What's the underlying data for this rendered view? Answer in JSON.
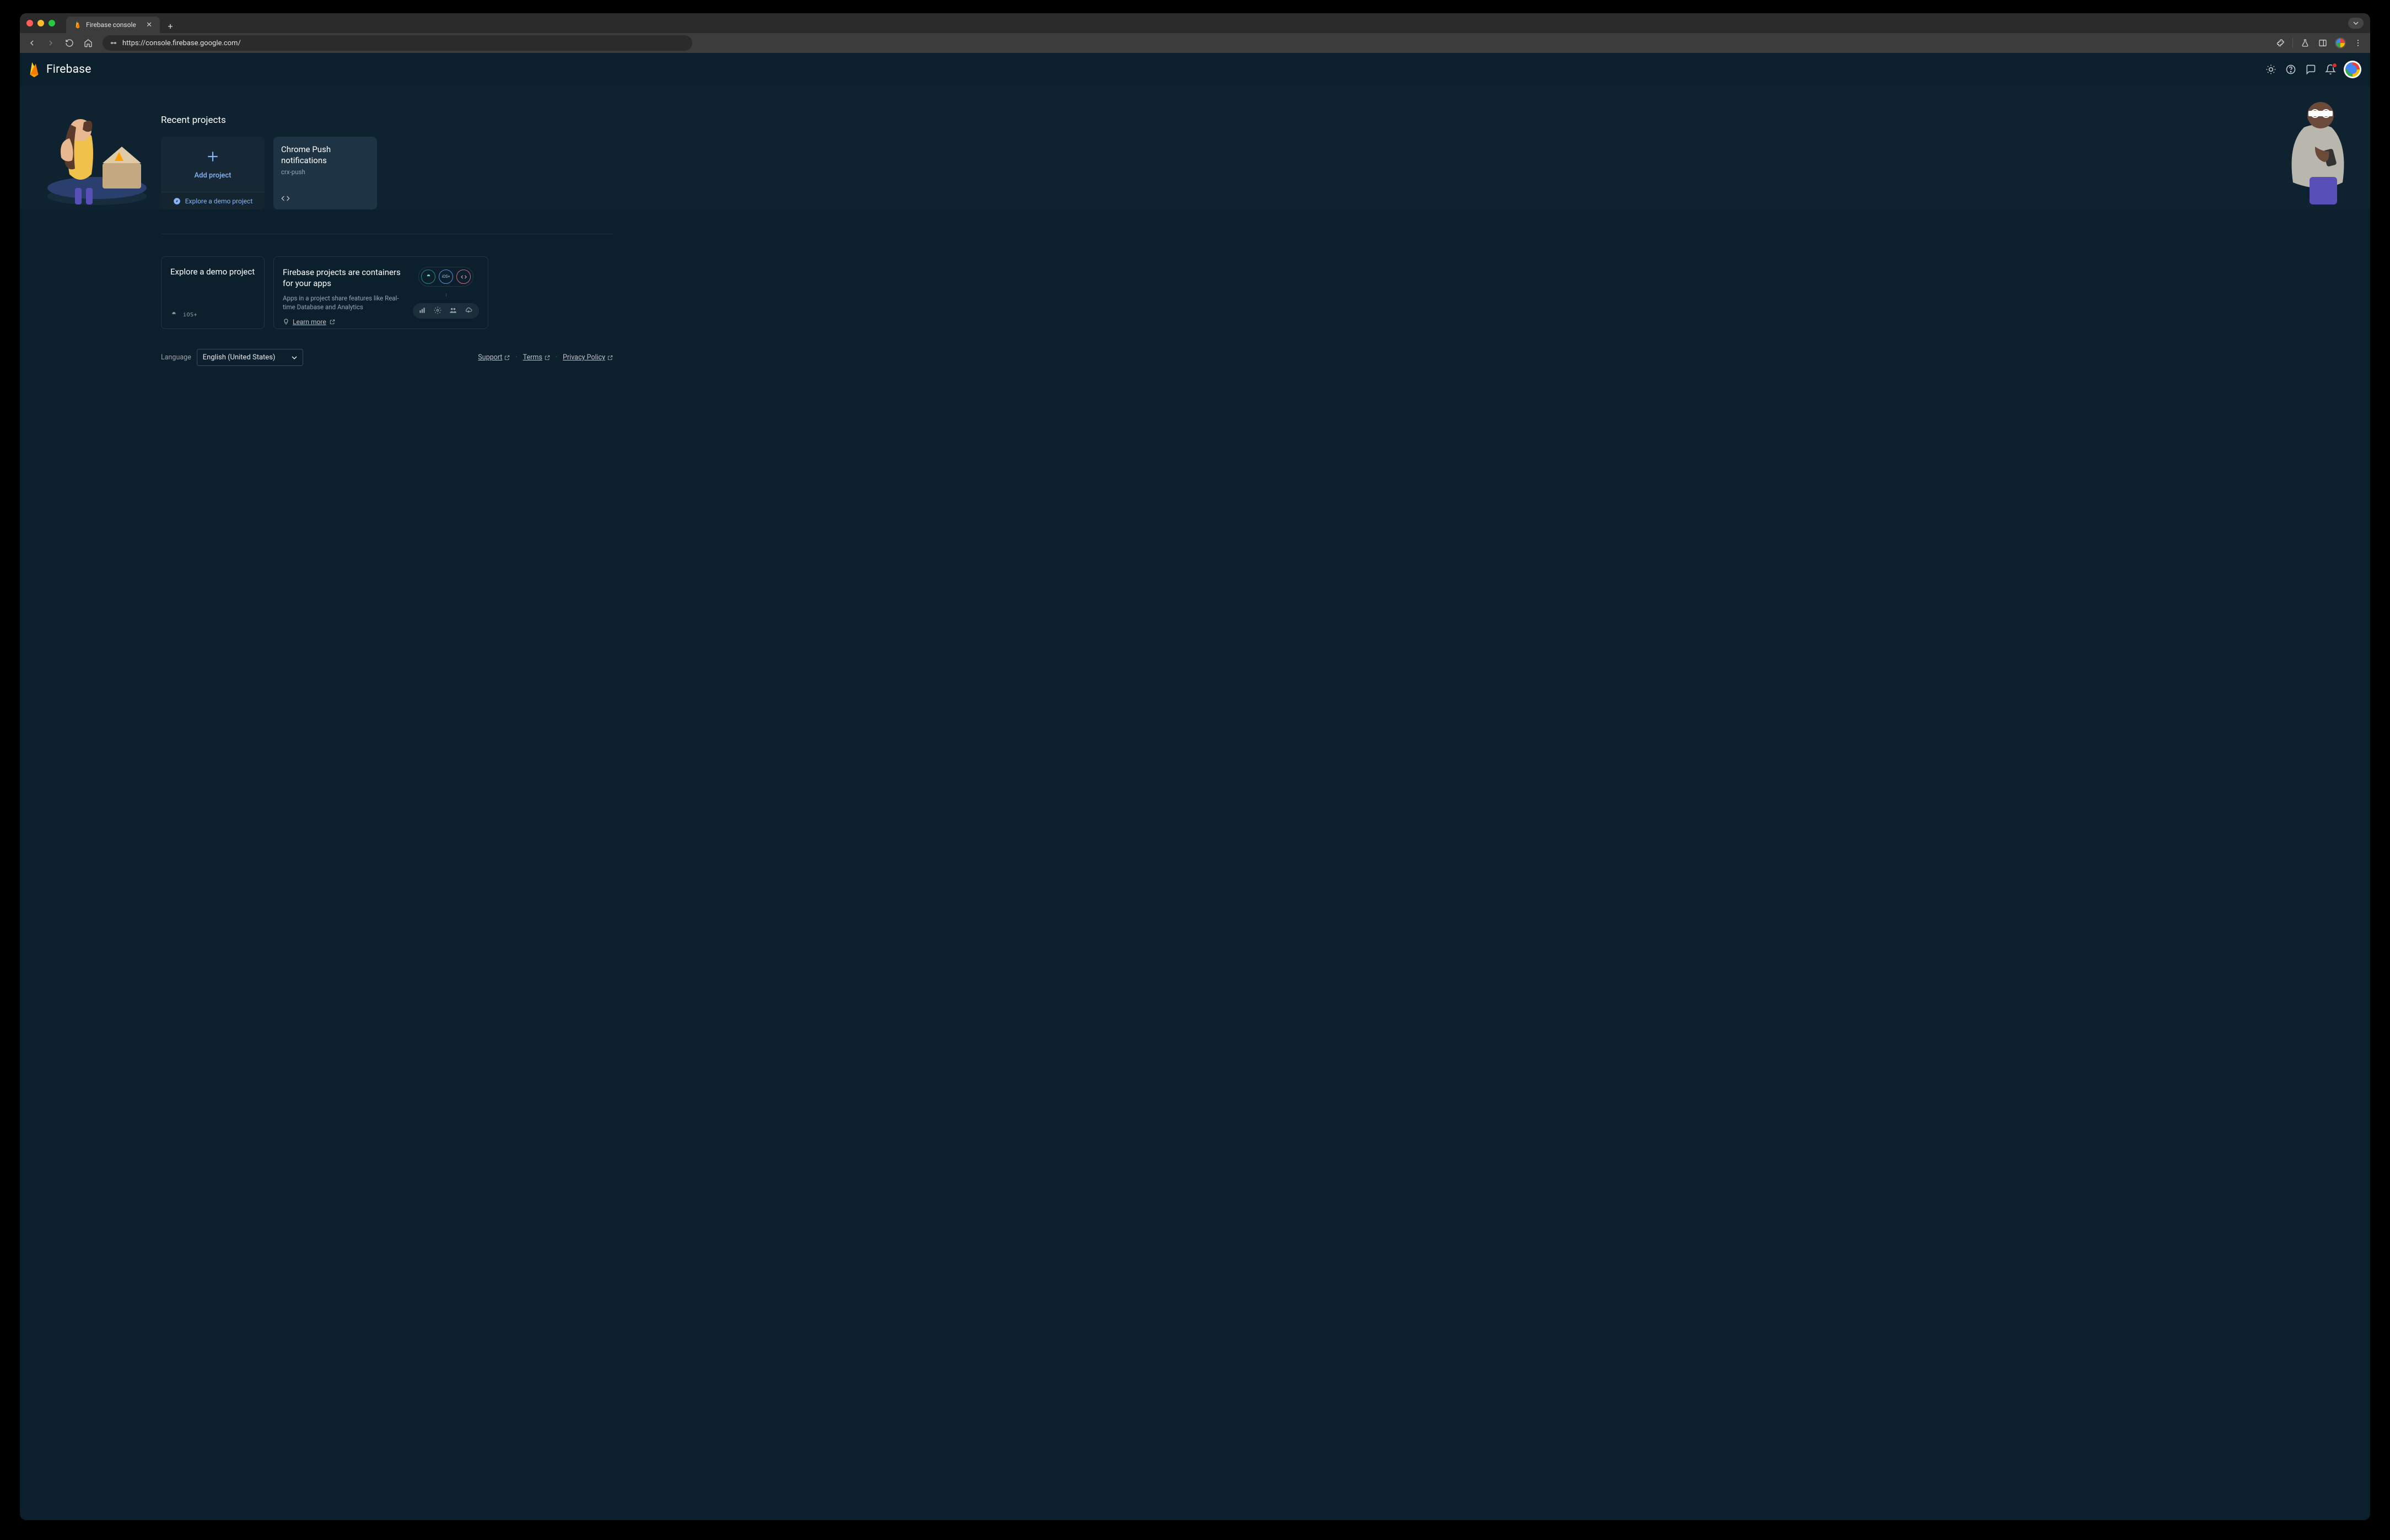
{
  "browser": {
    "tab_title": "Firebase console",
    "url": "https://console.firebase.google.com/"
  },
  "header": {
    "product_name": "Firebase"
  },
  "recent": {
    "title": "Recent projects",
    "add_project_label": "Add project",
    "demo_link_label": "Explore a demo project",
    "projects": [
      {
        "name": "Chrome Push notifications",
        "id": "crx-push",
        "platform": "web"
      }
    ]
  },
  "explore_card": {
    "title": "Explore a demo project"
  },
  "containers_card": {
    "title": "Firebase projects are containers for your apps",
    "subtitle": "Apps in a project share features like Real-time Database and Analytics",
    "learn_more_label": "Learn more"
  },
  "footer": {
    "language_label": "Language",
    "language_value": "English (United States)",
    "links": {
      "support": "Support",
      "terms": "Terms",
      "privacy": "Privacy Policy"
    }
  }
}
